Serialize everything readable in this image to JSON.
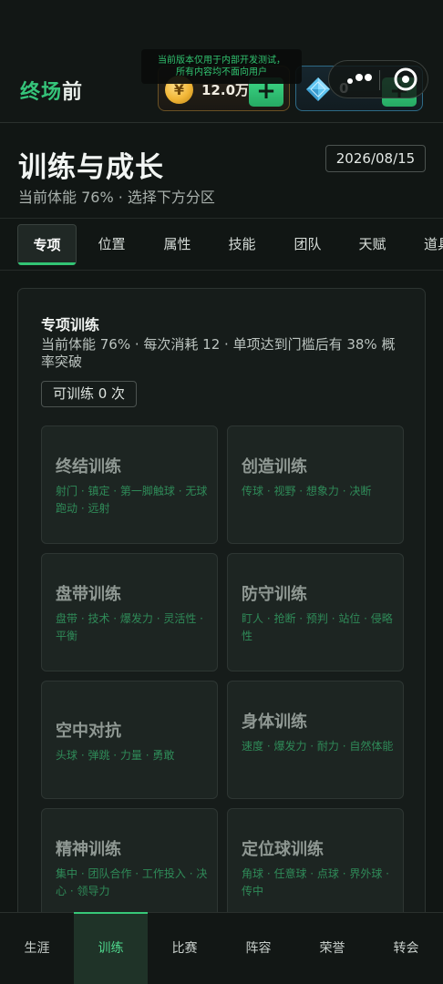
{
  "brand": {
    "part1": "终场",
    "part2": "前"
  },
  "notice": {
    "line1": "当前版本仅用于内部开发测试，",
    "line2": "所有内容均不面向用户"
  },
  "currency": {
    "coin_icon": "¥",
    "coin_value": "12.0万",
    "gem_value": "0",
    "plus_label": "+"
  },
  "page": {
    "title": "训练与成长",
    "subtitle": "当前体能 76% · 选择下方分区",
    "date": "2026/08/15"
  },
  "tabs": [
    {
      "label": "专项",
      "active": true
    },
    {
      "label": "位置"
    },
    {
      "label": "属性"
    },
    {
      "label": "技能"
    },
    {
      "label": "团队"
    },
    {
      "label": "天赋"
    },
    {
      "label": "道具"
    }
  ],
  "training": {
    "title": "专项训练",
    "description": "当前体能 76% · 每次消耗 12 · 单项达到门槛后有 38% 概率突破",
    "available": "可训练 0 次",
    "tiles": [
      {
        "title": "终结训练",
        "tags": "射门 · 镇定 · 第一脚触球 · 无球跑动 · 远射"
      },
      {
        "title": "创造训练",
        "tags": "传球 · 视野 · 想象力 · 决断"
      },
      {
        "title": "盘带训练",
        "tags": "盘带 · 技术 · 爆发力 · 灵活性 · 平衡"
      },
      {
        "title": "防守训练",
        "tags": "盯人 · 抢断 · 预判 · 站位 · 侵略性"
      },
      {
        "title": "空中对抗",
        "tags": "头球 · 弹跳 · 力量 · 勇敢"
      },
      {
        "title": "身体训练",
        "tags": "速度 · 爆发力 · 耐力 · 自然体能"
      },
      {
        "title": "精神训练",
        "tags": "集中 · 团队合作 · 工作投入 · 决心 · 领导力"
      },
      {
        "title": "定位球训练",
        "tags": "角球 · 任意球 · 点球 · 界外球 · 传中"
      }
    ]
  },
  "nav": [
    {
      "label": "生涯"
    },
    {
      "label": "训练",
      "active": true
    },
    {
      "label": "比赛"
    },
    {
      "label": "阵容"
    },
    {
      "label": "荣誉"
    },
    {
      "label": "转会"
    }
  ],
  "colors": {
    "accent": "#32c474",
    "background": "#111614",
    "tag_green": "#2f8a58"
  },
  "icons": {
    "coin": "coin-icon",
    "gem": "diamond-icon",
    "more": "more-dots-icon",
    "target": "target-icon"
  }
}
